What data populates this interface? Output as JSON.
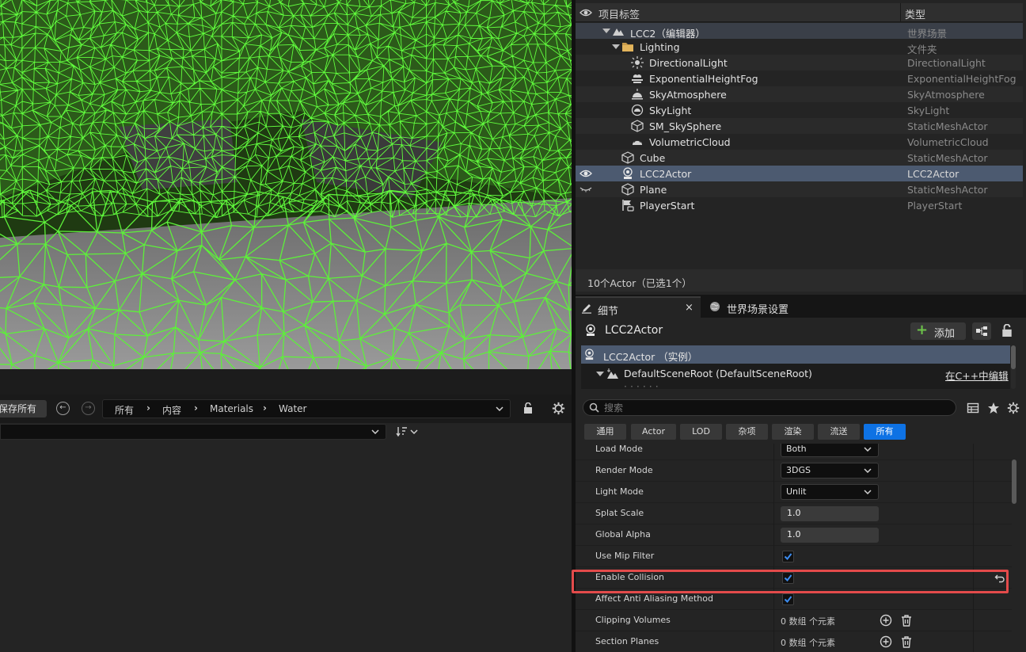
{
  "content_browser": {
    "save_all": "保存所有",
    "breadcrumb": [
      "所有",
      "内容",
      "Materials",
      "Water"
    ]
  },
  "outliner": {
    "col_label": "项目标签",
    "col_type": "类型",
    "rows": [
      {
        "name": "LCC2（编辑器）",
        "type": "世界场景",
        "icon": "world-icon"
      },
      {
        "name": "Lighting",
        "type": "文件夹",
        "icon": "folder-icon"
      },
      {
        "name": "DirectionalLight",
        "type": "DirectionalLight",
        "icon": "directional-light-icon"
      },
      {
        "name": "ExponentialHeightFog",
        "type": "ExponentialHeightFog",
        "icon": "fog-icon"
      },
      {
        "name": "SkyAtmosphere",
        "type": "SkyAtmosphere",
        "icon": "sky-atmosphere-icon"
      },
      {
        "name": "SkyLight",
        "type": "SkyLight",
        "icon": "sky-light-icon"
      },
      {
        "name": "SM_SkySphere",
        "type": "StaticMeshActor",
        "icon": "static-mesh-icon"
      },
      {
        "name": "VolumetricCloud",
        "type": "VolumetricCloud",
        "icon": "cloud-icon"
      },
      {
        "name": "Cube",
        "type": "StaticMeshActor",
        "icon": "static-mesh-icon"
      },
      {
        "name": "LCC2Actor",
        "type": "LCC2Actor",
        "icon": "actor-icon"
      },
      {
        "name": "Plane",
        "type": "StaticMeshActor",
        "icon": "static-mesh-icon"
      },
      {
        "name": "PlayerStart",
        "type": "PlayerStart",
        "icon": "player-start-icon"
      }
    ],
    "footer": "10个Actor（已选1个）"
  },
  "details": {
    "tab_details": "细节",
    "tab_world_settings": "世界场景设置",
    "actor_name": "LCC2Actor",
    "add_label": "添加",
    "component_instance": "LCC2Actor （实例）",
    "component_root": "DefaultSceneRoot (DefaultSceneRoot)",
    "edit_in_cpp": "在C++中编辑",
    "search_placeholder": "搜索",
    "filter_tabs": [
      "通用",
      "Actor",
      "LOD",
      "杂项",
      "渲染",
      "流送",
      "所有"
    ],
    "active_filter": "所有",
    "props": {
      "load_mode": {
        "label": "Load Mode",
        "value": "Both"
      },
      "render_mode": {
        "label": "Render Mode",
        "value": "3DGS"
      },
      "light_mode": {
        "label": "Light Mode",
        "value": "Unlit"
      },
      "splat_scale": {
        "label": "Splat Scale",
        "value": "1.0"
      },
      "global_alpha": {
        "label": "Global Alpha",
        "value": "1.0"
      },
      "use_mip_filter": {
        "label": "Use Mip Filter",
        "checked": true
      },
      "enable_collision": {
        "label": "Enable Collision",
        "checked": true
      },
      "affect_aa": {
        "label": "Affect Anti Aliasing Method",
        "checked": true
      },
      "clipping_volumes": {
        "label": "Clipping Volumes",
        "value": "0 数组 个元素"
      },
      "section_planes": {
        "label": "Section Planes",
        "value": "0 数组 个元素"
      }
    }
  },
  "colors": {
    "accent_blue": "#0e72e4",
    "selection": "#4c5a70",
    "highlight_red": "#e34b4b",
    "wireframe_green": "#5df03a"
  }
}
